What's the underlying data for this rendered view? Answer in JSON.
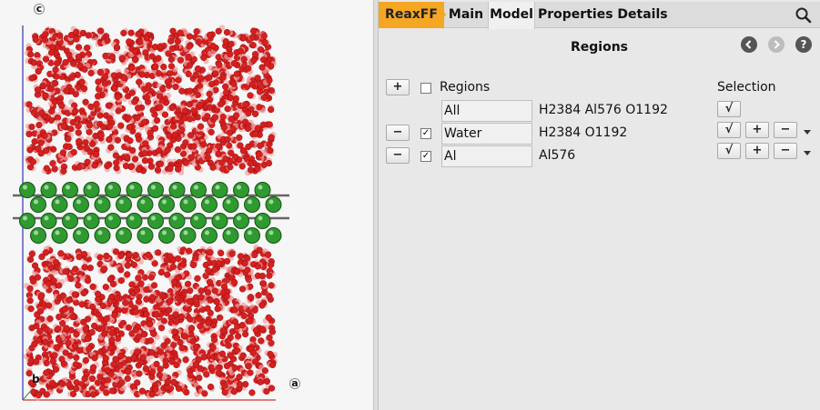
{
  "viewport": {
    "axis_labels": {
      "top": "c",
      "bottom_left": "b",
      "bottom_right": "a"
    },
    "colors": {
      "oxygen": "#d42020",
      "hydrogen": "#f2a0a0",
      "aluminum": "#2f9a2f",
      "axis_y": "#3333aa",
      "axis_x": "#cc3333"
    }
  },
  "tabs": [
    {
      "id": "reaxff",
      "label": "ReaxFF"
    },
    {
      "id": "main",
      "label": "Main"
    },
    {
      "id": "model",
      "label": "Model"
    },
    {
      "id": "properties",
      "label": "Properties"
    },
    {
      "id": "details",
      "label": "Details"
    }
  ],
  "search": {
    "icon": "search-icon"
  },
  "page": {
    "title": "Regions"
  },
  "nav": {
    "back_icon": "chevron-left-icon",
    "forward_icon": "chevron-right-icon",
    "help": "?"
  },
  "regions": {
    "add_label": "+",
    "header": "Regions",
    "selection_header": "Selection",
    "rows": [
      {
        "name": "All",
        "composition": "H2384 Al576 O1192",
        "checked": false
      },
      {
        "name": "Water",
        "composition": "H2384 O1192",
        "checked": true
      },
      {
        "name": "Al",
        "composition": "Al576",
        "checked": true
      }
    ],
    "remove_label": "−",
    "check_mark": "✓",
    "select_label": "√",
    "plus_label": "+",
    "minus_label": "−"
  },
  "accent_color": "#f5a623"
}
